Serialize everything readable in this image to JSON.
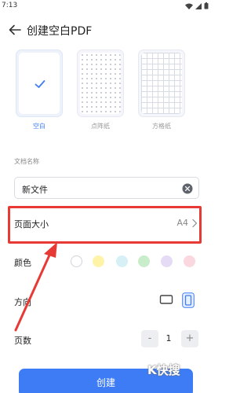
{
  "status_bar": {
    "time": "7:13"
  },
  "header": {
    "title": "创建空白PDF"
  },
  "templates": [
    {
      "label": "空白",
      "selected": true
    },
    {
      "label": "点阵纸",
      "selected": false
    },
    {
      "label": "方格纸",
      "selected": false
    }
  ],
  "doc_name": {
    "label": "文档名称",
    "value": "新文件"
  },
  "page_size": {
    "label": "页面大小",
    "value": "A4"
  },
  "color": {
    "label": "颜色",
    "options": [
      "#ffffff",
      "#fff3a8",
      "#d6f0f5",
      "#c9eccb",
      "#e6dbf7",
      "#fbd7e0"
    ],
    "selected_index": 0
  },
  "orientation": {
    "label": "方向",
    "selected": "portrait"
  },
  "page_count": {
    "label": "页数",
    "value": "1",
    "minus": "-",
    "plus": "+"
  },
  "create_button": {
    "label": "创建"
  },
  "accent_color": "#3d7cf5",
  "annotation_color": "#e83a35",
  "watermark": {
    "text": "K快搜"
  }
}
